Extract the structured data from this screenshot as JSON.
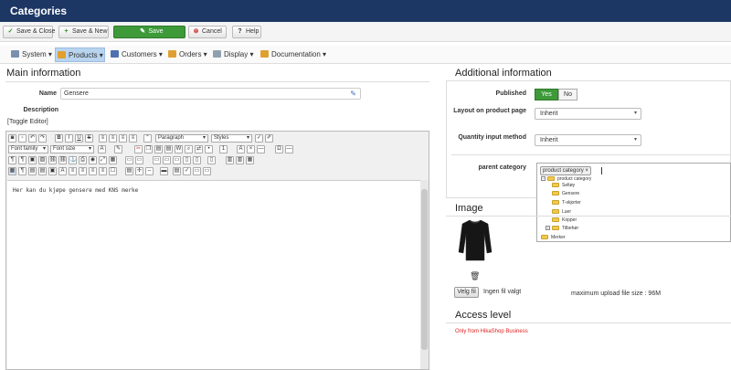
{
  "header": {
    "title": "Categories"
  },
  "toolbar": {
    "save_close": "Save & Close",
    "save_new": "Save & New",
    "save": "Save",
    "cancel": "Cancel",
    "help": "Help"
  },
  "menu": {
    "system": "System",
    "products": "Products",
    "customers": "Customers",
    "orders": "Orders",
    "display": "Display",
    "documentation": "Documentation"
  },
  "main": {
    "title": "Main information",
    "name_label": "Name",
    "name_value": "Gensere",
    "description_label": "Description",
    "toggle_editor": "[Toggle Editor]",
    "editor": {
      "format_select": "Paragraph",
      "styles_select": "Styles",
      "font_family_select": "Font family",
      "font_size_select": "Font size",
      "content": "Her kan du kjøpe gensere med KNS merke"
    }
  },
  "additional": {
    "title": "Additional information",
    "published_label": "Published",
    "published_yes": "Yes",
    "published_no": "No",
    "layout_label": "Layout on product page",
    "layout_value": "Inherit",
    "quantity_label": "Quantity input method",
    "quantity_value": "Inherit",
    "parent_label": "parent category",
    "parent_tag": "product category",
    "tree": {
      "root": "product category",
      "items": [
        "Seltøy",
        "Gensere",
        "T-skjorter",
        "Luer",
        "Kopper",
        "Tilbehør"
      ],
      "bottom": "Merker"
    }
  },
  "image": {
    "title": "Image",
    "choose_file": "Velg fil",
    "no_file": "Ingen fil valgt",
    "max_size": "maximum upload file size : 96M"
  },
  "access": {
    "title": "Access level",
    "note": "Only from HikaShop Business"
  },
  "colors": {
    "header_bg": "#1c3764",
    "save_green": "#3e9a39",
    "access_note": "#e02020"
  }
}
